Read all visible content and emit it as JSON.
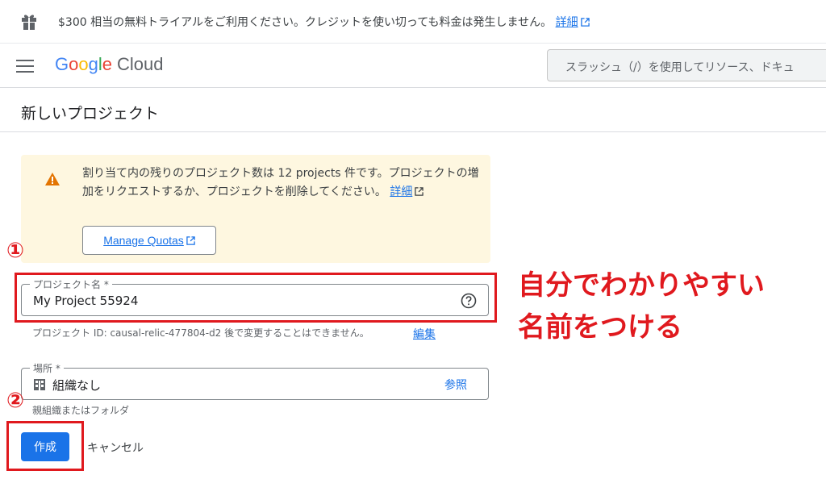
{
  "banner": {
    "text": "$300 相当の無料トライアルをご利用ください。クレジットを使い切っても料金は発生しません。",
    "link": "詳細"
  },
  "header": {
    "logo_parts": [
      "G",
      "o",
      "o",
      "g",
      "l",
      "e"
    ],
    "logo_product": "Cloud",
    "search_placeholder": "スラッシュ（/）を使用してリソース、ドキュ"
  },
  "page": {
    "title": "新しいプロジェクト"
  },
  "notice": {
    "text": "割り当て内の残りのプロジェクト数は 12 projects 件です。プロジェクトの増加をリクエストするか、プロジェクトを削除してください。",
    "link": "詳細",
    "button": "Manage Quotas"
  },
  "project_name": {
    "label": "プロジェクト名 *",
    "value": "My Project 55924",
    "hint": "プロジェクト ID: causal-relic-477804-d2 後で変更することはできません。",
    "edit_link": "編集"
  },
  "location": {
    "label": "場所 *",
    "value": "組織なし",
    "browse": "参照",
    "hint": "親組織またはフォルダ"
  },
  "actions": {
    "create": "作成",
    "cancel": "キャンセル"
  },
  "annotations": {
    "num1": "①",
    "num2": "②",
    "line1": "自分でわかりやすい",
    "line2": "名前をつける"
  },
  "colors": {
    "accent": "#1a73e8",
    "annotation_red": "#e0191e",
    "notice_bg": "#fef7e0",
    "warning": "#e37400"
  }
}
